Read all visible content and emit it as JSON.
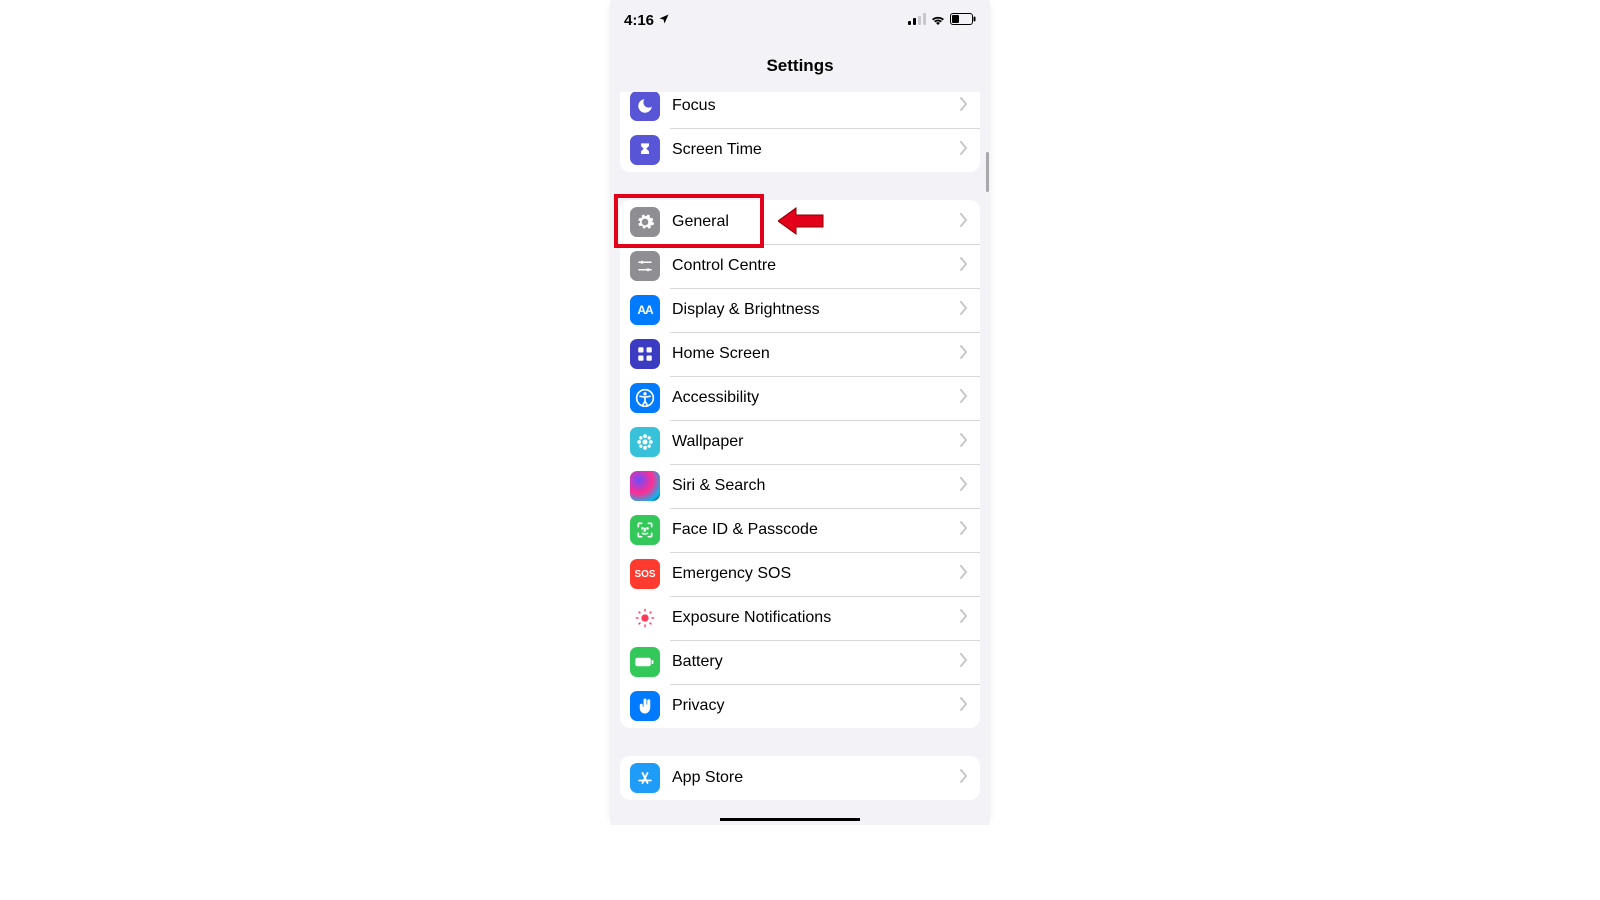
{
  "status": {
    "time": "4:16",
    "location_icon": "location-arrow",
    "cellular_bars": 2,
    "wifi_on": true,
    "battery_level": 30
  },
  "header": {
    "title": "Settings"
  },
  "groups": [
    {
      "rows": [
        {
          "id": "focus",
          "label": "Focus",
          "icon": "moon",
          "color": "#5856d6"
        },
        {
          "id": "screen-time",
          "label": "Screen Time",
          "icon": "hourglass",
          "color": "#5856d6"
        }
      ]
    },
    {
      "rows": [
        {
          "id": "general",
          "label": "General",
          "icon": "gear",
          "color": "#8e8e93",
          "highlighted": true
        },
        {
          "id": "control-centre",
          "label": "Control Centre",
          "icon": "sliders",
          "color": "#8e8e93"
        },
        {
          "id": "display-brightness",
          "label": "Display & Brightness",
          "icon": "text-size",
          "color": "#007aff",
          "glyph": "AA"
        },
        {
          "id": "home-screen",
          "label": "Home Screen",
          "icon": "grid",
          "color": "#3c3cc2"
        },
        {
          "id": "accessibility",
          "label": "Accessibility",
          "icon": "accessibility",
          "color": "#007aff"
        },
        {
          "id": "wallpaper",
          "label": "Wallpaper",
          "icon": "flower",
          "color": "#37c2d9"
        },
        {
          "id": "siri-search",
          "label": "Siri & Search",
          "icon": "siri-orb",
          "color": "#1c1c1e"
        },
        {
          "id": "face-id-passcode",
          "label": "Face ID & Passcode",
          "icon": "face-id",
          "color": "#34c759"
        },
        {
          "id": "emergency-sos",
          "label": "Emergency SOS",
          "icon": "sos-text",
          "color": "#ff3b30",
          "glyph": "SOS"
        },
        {
          "id": "exposure-notifications",
          "label": "Exposure Notifications",
          "icon": "exposure-dot",
          "color": "#ffffff"
        },
        {
          "id": "battery",
          "label": "Battery",
          "icon": "battery",
          "color": "#34c759"
        },
        {
          "id": "privacy",
          "label": "Privacy",
          "icon": "hand",
          "color": "#007aff"
        }
      ]
    },
    {
      "rows": [
        {
          "id": "app-store",
          "label": "App Store",
          "icon": "app-store",
          "color": "#1e9cf7"
        }
      ]
    }
  ],
  "annotation": {
    "target_row": "general",
    "arrow_color": "#e2001a"
  }
}
